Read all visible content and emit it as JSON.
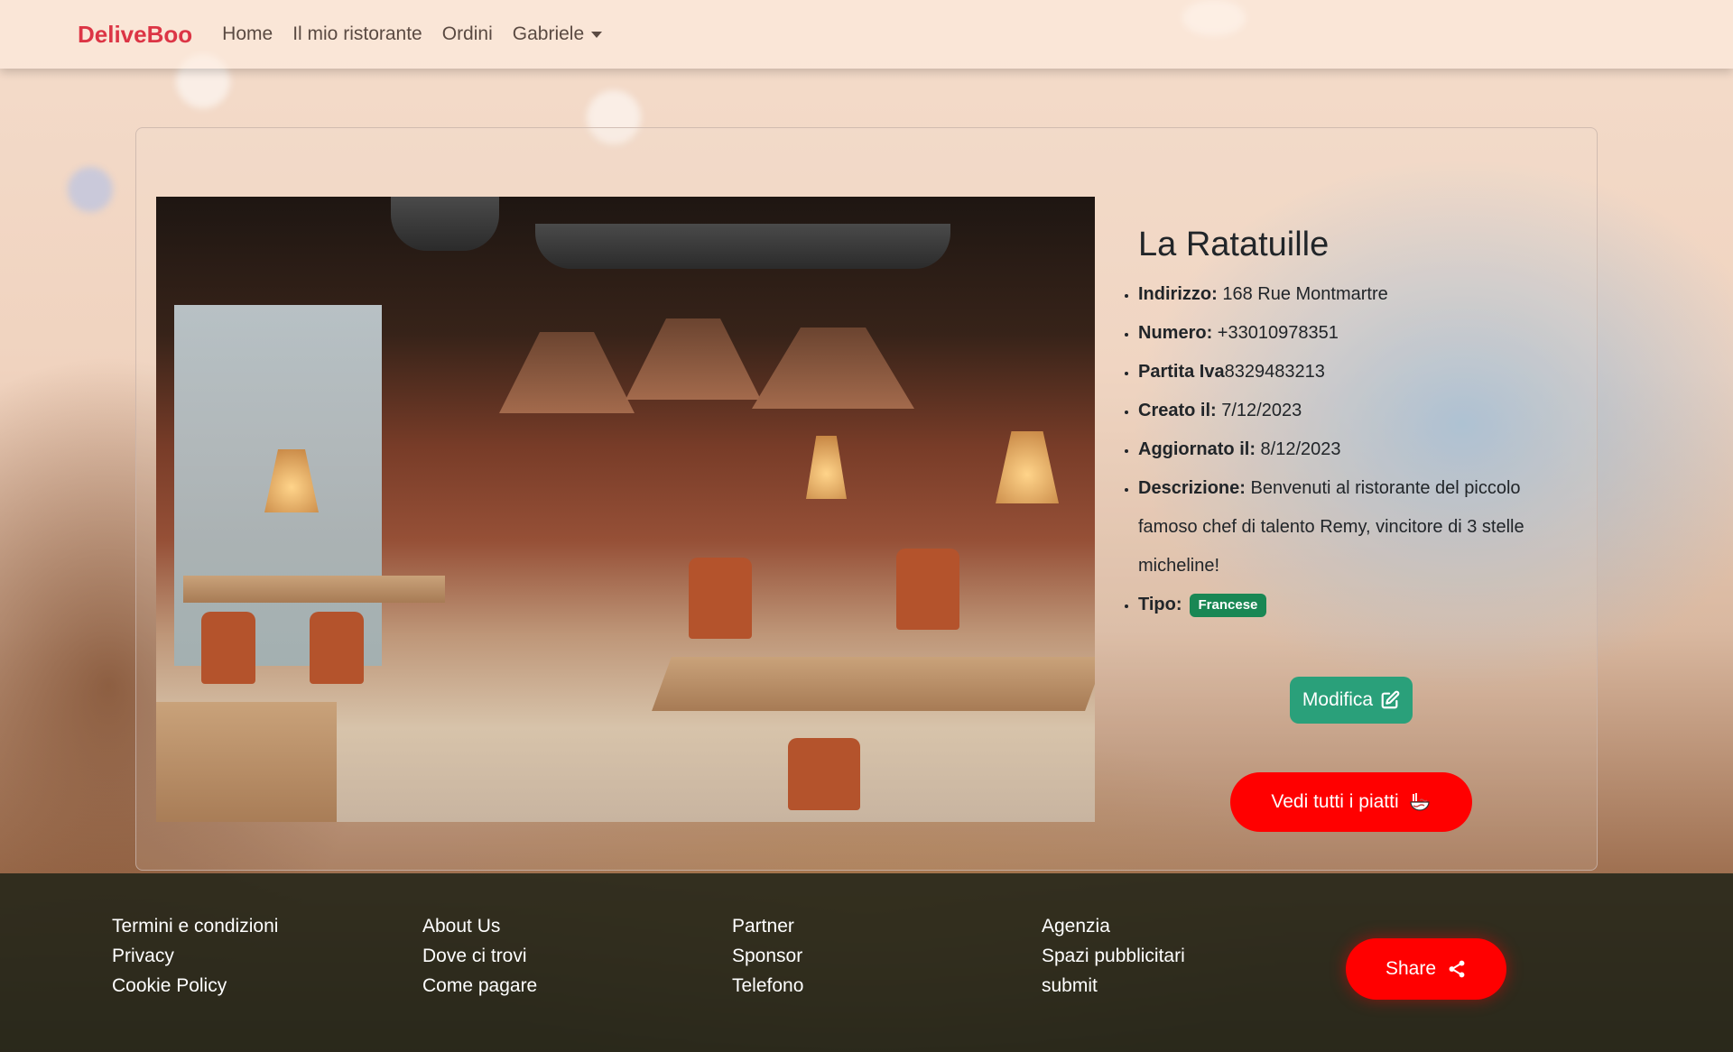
{
  "navbar": {
    "brand": "DeliveBoo",
    "links": [
      "Home",
      "Il mio ristorante",
      "Ordini"
    ],
    "user_menu": "Gabriele"
  },
  "restaurant": {
    "name": "La Ratatuille",
    "fields": [
      {
        "label": "Indirizzo:",
        "value": " 168 Rue Montmartre"
      },
      {
        "label": "Numero:",
        "value": " +33010978351"
      },
      {
        "label": "Partita Iva",
        "value": "8329483213"
      },
      {
        "label": "Creato il:",
        "value": " 7/12/2023"
      },
      {
        "label": "Aggiornato il:",
        "value": " 8/12/2023"
      },
      {
        "label": "Descrizione:",
        "value": " Benvenuti al ristorante del piccolo famoso chef di talento Remy, vincitore di 3 stelle micheline!"
      }
    ],
    "type_label": "Tipo:",
    "type_badge": "Francese"
  },
  "actions": {
    "edit_label": "Modifica",
    "dishes_label": "Vedi tutti i piatti"
  },
  "footer": {
    "columns": [
      [
        "Termini e condizioni",
        "Privacy",
        "Cookie Policy"
      ],
      [
        "About Us",
        "Dove ci trovi",
        "Come pagare"
      ],
      [
        "Partner",
        "Sponsor",
        "Telefono"
      ],
      [
        "Agenzia",
        "Spazi pubblicitari",
        "submit"
      ]
    ],
    "share_label": "Share"
  },
  "colors": {
    "brand": "#dc3545",
    "edit_button": "#2aa07a",
    "dishes_button": "#ff0000",
    "badge": "#198754",
    "share_button": "#ff0000"
  },
  "icons": [
    "edit-icon",
    "noodle-bowl-icon",
    "share-icon",
    "chevron-down-icon"
  ]
}
